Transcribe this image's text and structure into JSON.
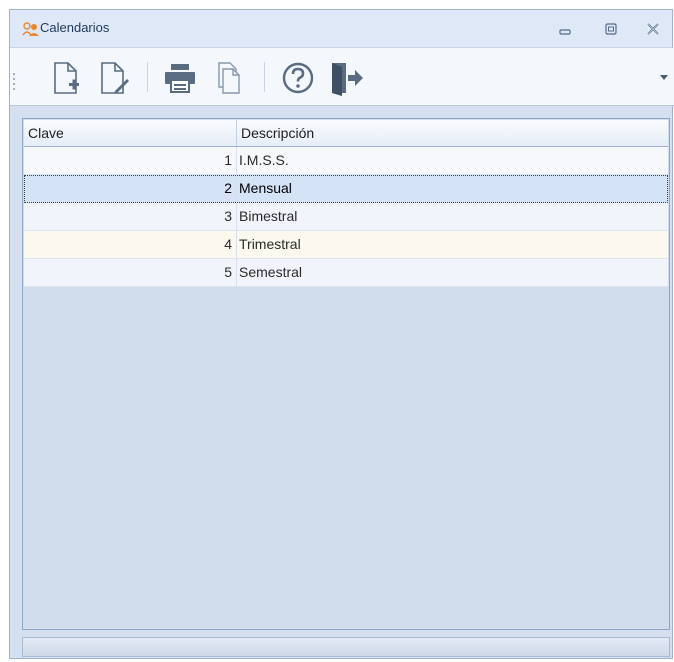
{
  "window": {
    "title": "Calendarios"
  },
  "toolbar": {
    "buttons": [
      {
        "icon": "new-document-icon"
      },
      {
        "icon": "edit-document-icon"
      },
      {
        "icon": "print-icon"
      },
      {
        "icon": "copy-icon"
      },
      {
        "icon": "help-icon"
      },
      {
        "icon": "exit-icon"
      }
    ]
  },
  "grid": {
    "columns": [
      "Clave",
      "Descripción"
    ],
    "rows": [
      {
        "clave": "1",
        "descripcion": "I.M.S.S."
      },
      {
        "clave": "2",
        "descripcion": "Mensual"
      },
      {
        "clave": "3",
        "descripcion": "Bimestral"
      },
      {
        "clave": "4",
        "descripcion": "Trimestral"
      },
      {
        "clave": "5",
        "descripcion": "Semestral"
      }
    ],
    "selected_row": 2
  },
  "colors": {
    "accent": "#1e395b",
    "icon": "#5a6c82",
    "selection": "#d5e3f7"
  }
}
